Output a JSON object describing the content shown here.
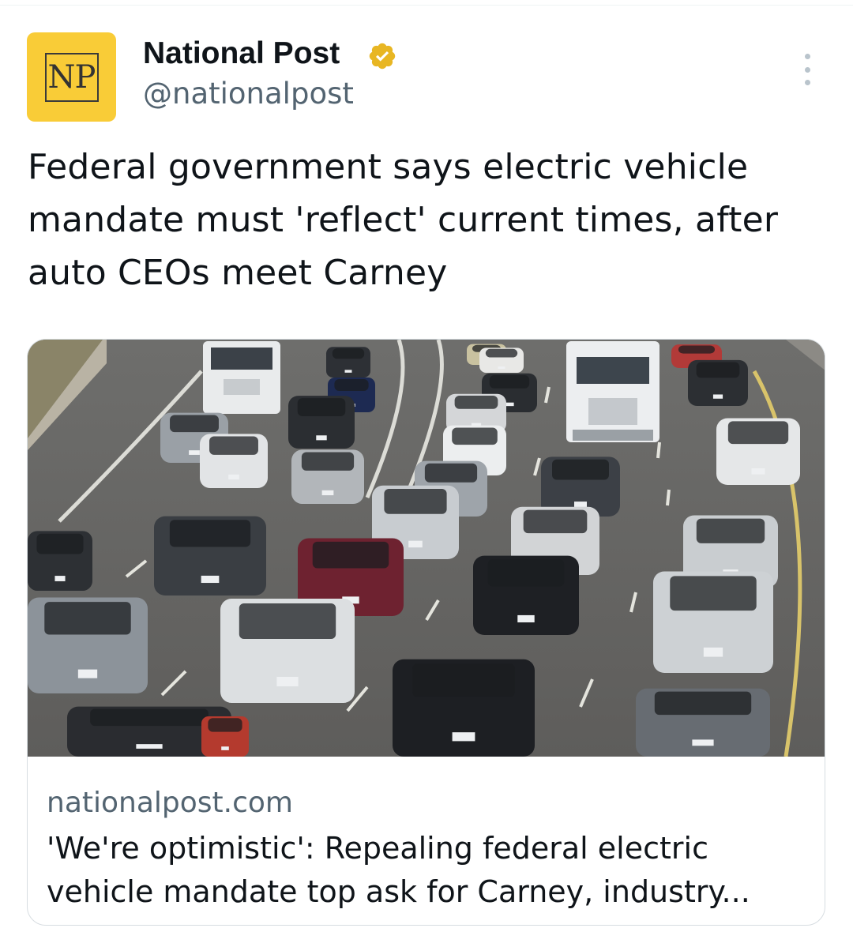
{
  "author": {
    "name": "National Post",
    "handle": "@nationalpost",
    "avatar_text": "NP",
    "verified_color": "#e8b623"
  },
  "tweet": {
    "lines": [
      "Federal government says electric vehicle",
      "mandate must 'reflect' current times, after",
      "auto CEOs meet Carney"
    ]
  },
  "card": {
    "domain": "nationalpost.com",
    "title_lines": [
      "'We're optimistic': Repealing federal electric",
      "vehicle mandate top ask for Carney, industry..."
    ]
  },
  "icons": {
    "verified": "verified-badge-icon",
    "more": "more-options-icon"
  }
}
